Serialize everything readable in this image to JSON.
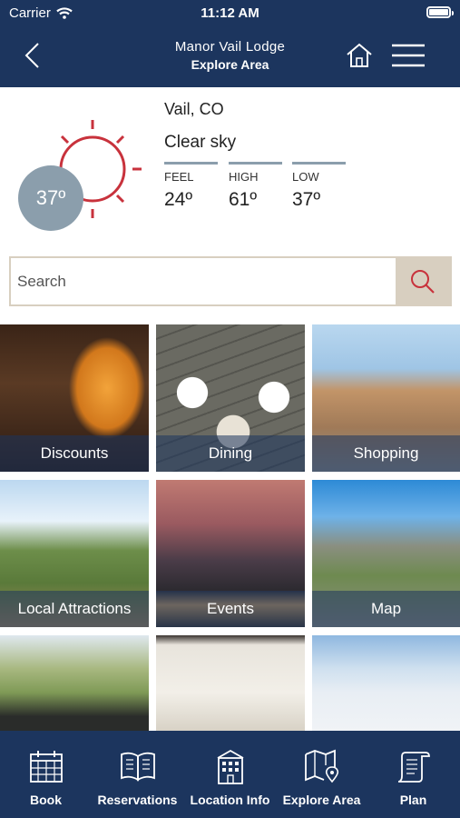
{
  "status_bar": {
    "carrier": "Carrier",
    "time": "11:12 AM"
  },
  "header": {
    "title": "Manor Vail Lodge",
    "subtitle": "Explore Area",
    "back_icon": "chevron-left-icon",
    "home_icon": "home-icon",
    "menu_icon": "hamburger-menu-icon"
  },
  "weather": {
    "location": "Vail, CO",
    "condition": "Clear sky",
    "current_temp": "37º",
    "feel_label": "FEEL",
    "feel_value": "24º",
    "high_label": "HIGH",
    "high_value": "61º",
    "low_label": "LOW",
    "low_value": "37º",
    "icon": "sun-icon",
    "accent_color": "#c8323c"
  },
  "search": {
    "placeholder": "Search",
    "value": "",
    "icon": "search-icon"
  },
  "tiles": [
    {
      "label": "Discounts"
    },
    {
      "label": "Dining"
    },
    {
      "label": "Shopping"
    },
    {
      "label": "Local Attractions"
    },
    {
      "label": "Events"
    },
    {
      "label": "Map"
    },
    {
      "label": ""
    },
    {
      "label": ""
    },
    {
      "label": ""
    }
  ],
  "bottom_nav": [
    {
      "label": "Book",
      "icon": "calendar-icon"
    },
    {
      "label": "Reservations",
      "icon": "book-icon"
    },
    {
      "label": "Location Info",
      "icon": "building-icon"
    },
    {
      "label": "Explore Area",
      "icon": "map-pin-icon"
    },
    {
      "label": "Plan",
      "icon": "scroll-icon"
    }
  ],
  "colors": {
    "brand": "#1c355e",
    "accent": "#c8323c",
    "muted": "#8b9eac",
    "search_btn": "#d8cfc0"
  }
}
